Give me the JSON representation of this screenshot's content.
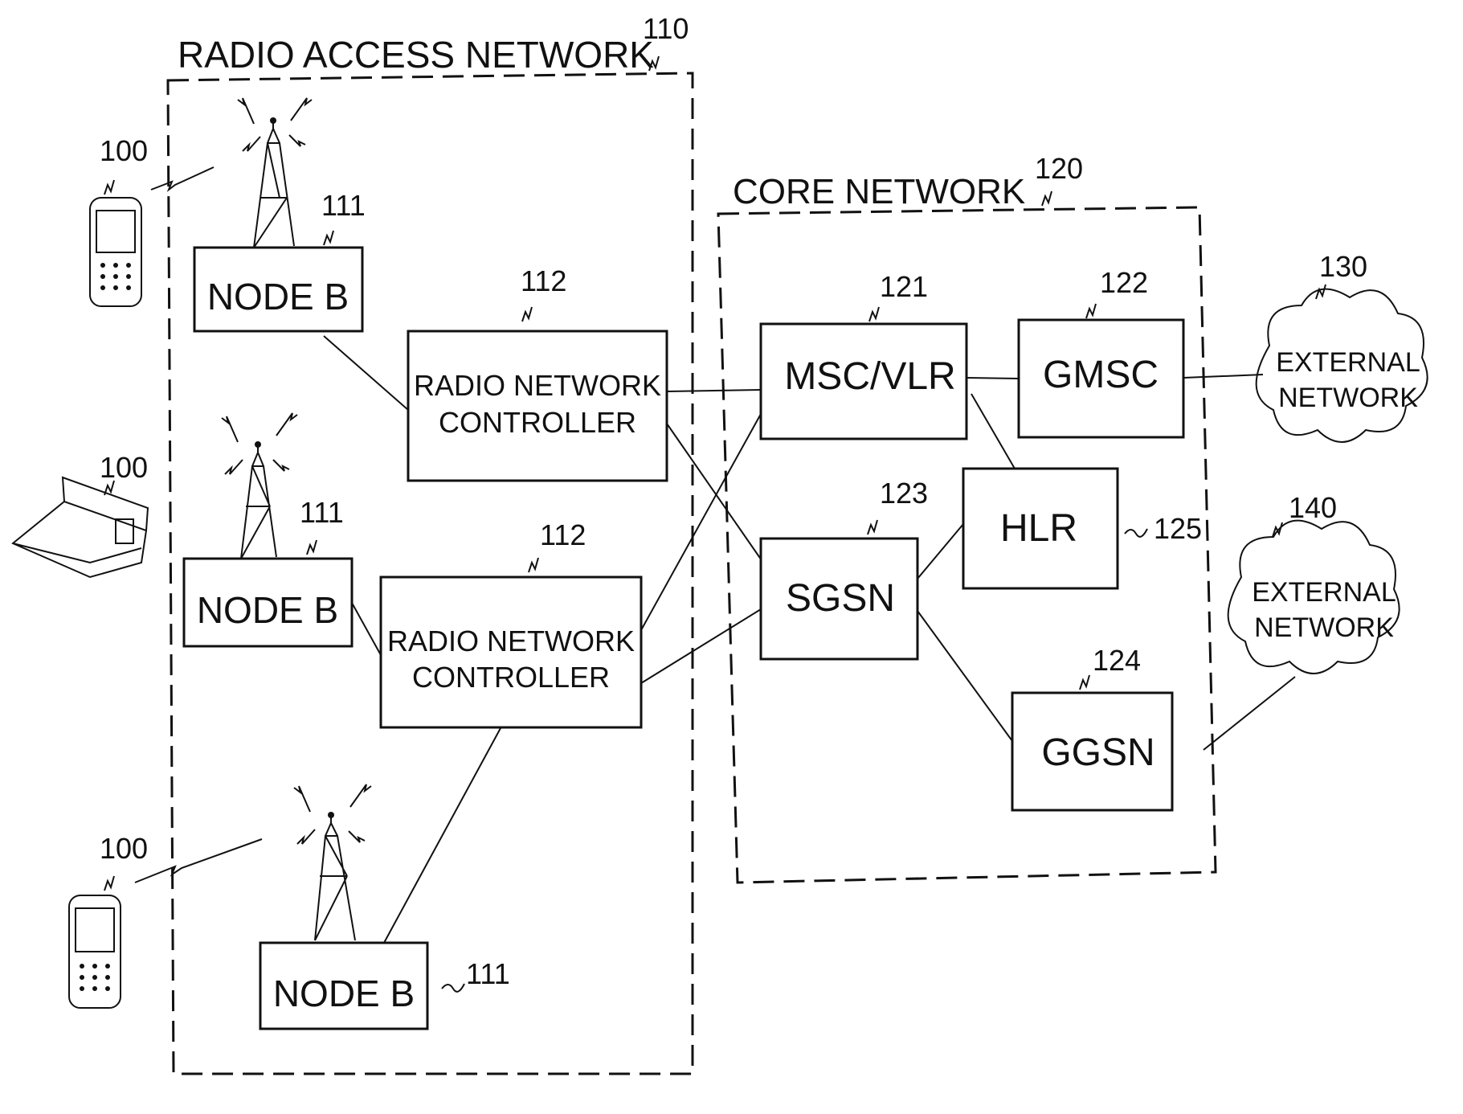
{
  "groups": {
    "ran": {
      "title": "RADIO ACCESS NETWORK",
      "ref": "110"
    },
    "core": {
      "title": "CORE NETWORK",
      "ref": "120"
    }
  },
  "nodes": {
    "nodeb1": {
      "label": "NODE B",
      "ref": "111"
    },
    "nodeb2": {
      "label": "NODE B",
      "ref": "111"
    },
    "nodeb3": {
      "label": "NODE B",
      "ref": "111"
    },
    "rnc1": {
      "line1": "RADIO NETWORK",
      "line2": "CONTROLLER",
      "ref": "112"
    },
    "rnc2": {
      "line1": "RADIO NETWORK",
      "line2": "CONTROLLER",
      "ref": "112"
    },
    "msc": {
      "label": "MSC/VLR",
      "ref": "121"
    },
    "gmsc": {
      "label": "GMSC",
      "ref": "122"
    },
    "sgsn": {
      "label": "SGSN",
      "ref": "123"
    },
    "ggsn": {
      "label": "GGSN",
      "ref": "124"
    },
    "hlr": {
      "label": "HLR",
      "ref": "125"
    },
    "ext1": {
      "line1": "EXTERNAL",
      "line2": "NETWORK",
      "ref": "130"
    },
    "ext2": {
      "line1": "EXTERNAL",
      "line2": "NETWORK",
      "ref": "140"
    }
  },
  "terminals": {
    "phone1": {
      "ref": "100",
      "type": "mobile-phone"
    },
    "laptop": {
      "ref": "100",
      "type": "laptop"
    },
    "phone2": {
      "ref": "100",
      "type": "mobile-phone"
    }
  },
  "connections": [
    [
      "nodeb1",
      "rnc1"
    ],
    [
      "nodeb2",
      "rnc2"
    ],
    [
      "nodeb3",
      "rnc2"
    ],
    [
      "rnc1",
      "msc"
    ],
    [
      "rnc1",
      "sgsn"
    ],
    [
      "rnc2",
      "msc"
    ],
    [
      "rnc2",
      "sgsn"
    ],
    [
      "msc",
      "gmsc"
    ],
    [
      "msc",
      "hlr"
    ],
    [
      "sgsn",
      "hlr"
    ],
    [
      "sgsn",
      "ggsn"
    ],
    [
      "gmsc",
      "ext1"
    ],
    [
      "ggsn",
      "ext2"
    ]
  ]
}
